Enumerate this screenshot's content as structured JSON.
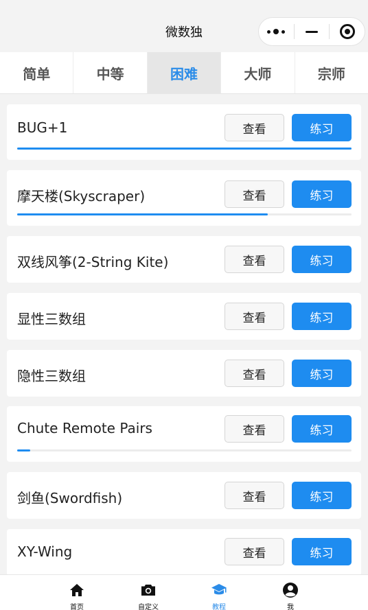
{
  "header": {
    "title": "微数独"
  },
  "tabs": [
    {
      "label": "简单",
      "active": false
    },
    {
      "label": "中等",
      "active": false
    },
    {
      "label": "困难",
      "active": true
    },
    {
      "label": "大师",
      "active": false
    },
    {
      "label": "宗师",
      "active": false
    }
  ],
  "buttons": {
    "view": "查看",
    "practice": "练习"
  },
  "techniques": [
    {
      "name": "BUG+1",
      "progress": 1.0
    },
    {
      "name": "摩天楼(Skyscraper)",
      "progress": 0.75
    },
    {
      "name": "双线风筝(2-String Kite)",
      "progress": null
    },
    {
      "name": "显性三数组",
      "progress": null
    },
    {
      "name": "隐性三数组",
      "progress": null
    },
    {
      "name": "Chute Remote Pairs",
      "progress": 0.04
    },
    {
      "name": "剑鱼(Swordfish)",
      "progress": null
    },
    {
      "name": "XY-Wing",
      "progress": null
    }
  ],
  "bottom_nav": [
    {
      "label": "首页",
      "icon": "home-icon",
      "active": false
    },
    {
      "label": "自定义",
      "icon": "camera-icon",
      "active": false
    },
    {
      "label": "教程",
      "icon": "graduation-cap-icon",
      "active": true
    },
    {
      "label": "我",
      "icon": "user-icon",
      "active": false
    }
  ],
  "colors": {
    "accent": "#1e8cf0",
    "active_tab_text": "#2b8ce8"
  }
}
